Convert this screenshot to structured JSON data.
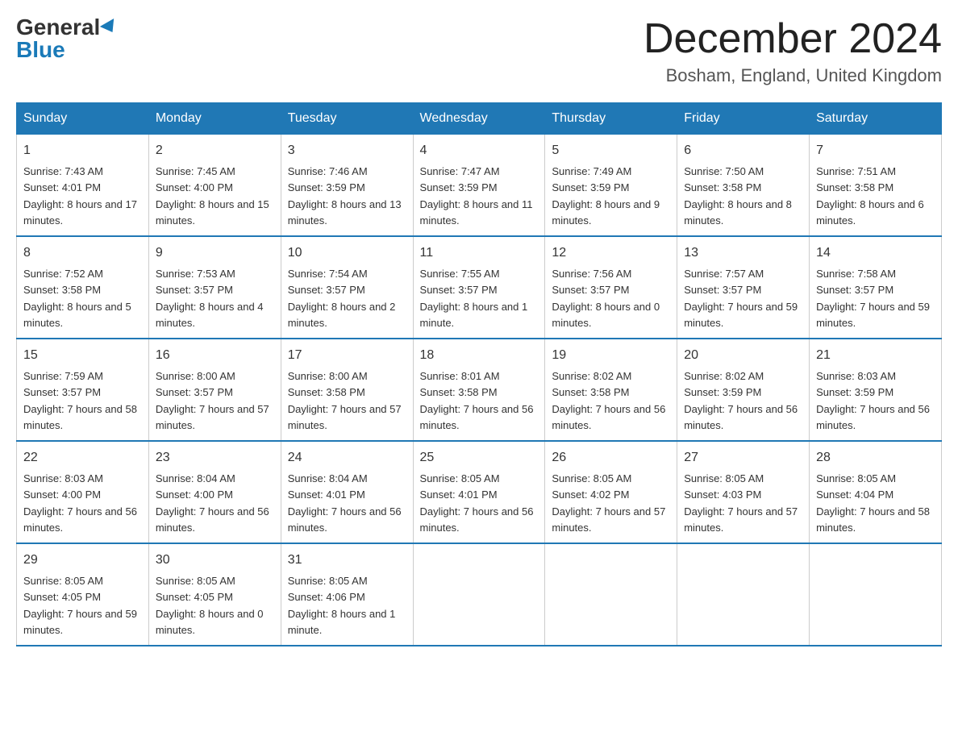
{
  "logo": {
    "general": "General",
    "blue": "Blue"
  },
  "title": "December 2024",
  "location": "Bosham, England, United Kingdom",
  "days_of_week": [
    "Sunday",
    "Monday",
    "Tuesday",
    "Wednesday",
    "Thursday",
    "Friday",
    "Saturday"
  ],
  "weeks": [
    [
      {
        "day": "1",
        "sunrise": "7:43 AM",
        "sunset": "4:01 PM",
        "daylight": "8 hours and 17 minutes."
      },
      {
        "day": "2",
        "sunrise": "7:45 AM",
        "sunset": "4:00 PM",
        "daylight": "8 hours and 15 minutes."
      },
      {
        "day": "3",
        "sunrise": "7:46 AM",
        "sunset": "3:59 PM",
        "daylight": "8 hours and 13 minutes."
      },
      {
        "day": "4",
        "sunrise": "7:47 AM",
        "sunset": "3:59 PM",
        "daylight": "8 hours and 11 minutes."
      },
      {
        "day": "5",
        "sunrise": "7:49 AM",
        "sunset": "3:59 PM",
        "daylight": "8 hours and 9 minutes."
      },
      {
        "day": "6",
        "sunrise": "7:50 AM",
        "sunset": "3:58 PM",
        "daylight": "8 hours and 8 minutes."
      },
      {
        "day": "7",
        "sunrise": "7:51 AM",
        "sunset": "3:58 PM",
        "daylight": "8 hours and 6 minutes."
      }
    ],
    [
      {
        "day": "8",
        "sunrise": "7:52 AM",
        "sunset": "3:58 PM",
        "daylight": "8 hours and 5 minutes."
      },
      {
        "day": "9",
        "sunrise": "7:53 AM",
        "sunset": "3:57 PM",
        "daylight": "8 hours and 4 minutes."
      },
      {
        "day": "10",
        "sunrise": "7:54 AM",
        "sunset": "3:57 PM",
        "daylight": "8 hours and 2 minutes."
      },
      {
        "day": "11",
        "sunrise": "7:55 AM",
        "sunset": "3:57 PM",
        "daylight": "8 hours and 1 minute."
      },
      {
        "day": "12",
        "sunrise": "7:56 AM",
        "sunset": "3:57 PM",
        "daylight": "8 hours and 0 minutes."
      },
      {
        "day": "13",
        "sunrise": "7:57 AM",
        "sunset": "3:57 PM",
        "daylight": "7 hours and 59 minutes."
      },
      {
        "day": "14",
        "sunrise": "7:58 AM",
        "sunset": "3:57 PM",
        "daylight": "7 hours and 59 minutes."
      }
    ],
    [
      {
        "day": "15",
        "sunrise": "7:59 AM",
        "sunset": "3:57 PM",
        "daylight": "7 hours and 58 minutes."
      },
      {
        "day": "16",
        "sunrise": "8:00 AM",
        "sunset": "3:57 PM",
        "daylight": "7 hours and 57 minutes."
      },
      {
        "day": "17",
        "sunrise": "8:00 AM",
        "sunset": "3:58 PM",
        "daylight": "7 hours and 57 minutes."
      },
      {
        "day": "18",
        "sunrise": "8:01 AM",
        "sunset": "3:58 PM",
        "daylight": "7 hours and 56 minutes."
      },
      {
        "day": "19",
        "sunrise": "8:02 AM",
        "sunset": "3:58 PM",
        "daylight": "7 hours and 56 minutes."
      },
      {
        "day": "20",
        "sunrise": "8:02 AM",
        "sunset": "3:59 PM",
        "daylight": "7 hours and 56 minutes."
      },
      {
        "day": "21",
        "sunrise": "8:03 AM",
        "sunset": "3:59 PM",
        "daylight": "7 hours and 56 minutes."
      }
    ],
    [
      {
        "day": "22",
        "sunrise": "8:03 AM",
        "sunset": "4:00 PM",
        "daylight": "7 hours and 56 minutes."
      },
      {
        "day": "23",
        "sunrise": "8:04 AM",
        "sunset": "4:00 PM",
        "daylight": "7 hours and 56 minutes."
      },
      {
        "day": "24",
        "sunrise": "8:04 AM",
        "sunset": "4:01 PM",
        "daylight": "7 hours and 56 minutes."
      },
      {
        "day": "25",
        "sunrise": "8:05 AM",
        "sunset": "4:01 PM",
        "daylight": "7 hours and 56 minutes."
      },
      {
        "day": "26",
        "sunrise": "8:05 AM",
        "sunset": "4:02 PM",
        "daylight": "7 hours and 57 minutes."
      },
      {
        "day": "27",
        "sunrise": "8:05 AM",
        "sunset": "4:03 PM",
        "daylight": "7 hours and 57 minutes."
      },
      {
        "day": "28",
        "sunrise": "8:05 AM",
        "sunset": "4:04 PM",
        "daylight": "7 hours and 58 minutes."
      }
    ],
    [
      {
        "day": "29",
        "sunrise": "8:05 AM",
        "sunset": "4:05 PM",
        "daylight": "7 hours and 59 minutes."
      },
      {
        "day": "30",
        "sunrise": "8:05 AM",
        "sunset": "4:05 PM",
        "daylight": "8 hours and 0 minutes."
      },
      {
        "day": "31",
        "sunrise": "8:05 AM",
        "sunset": "4:06 PM",
        "daylight": "8 hours and 1 minute."
      },
      null,
      null,
      null,
      null
    ]
  ]
}
